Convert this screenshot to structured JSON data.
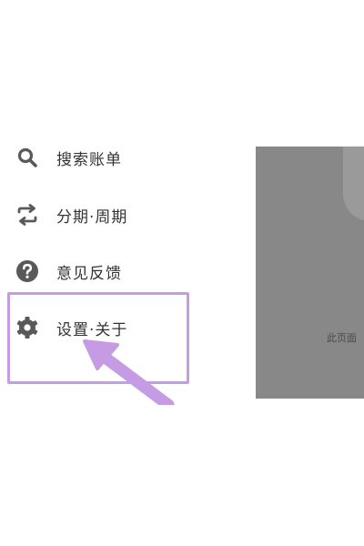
{
  "menu": {
    "items": [
      {
        "label": "搜索账单",
        "icon": "search-icon"
      },
      {
        "label": "分期·周期",
        "icon": "repeat-icon"
      },
      {
        "label": "意见反馈",
        "icon": "help-icon"
      },
      {
        "label": "设置·关于",
        "icon": "gear-icon"
      }
    ]
  },
  "overlay": {
    "peek_text": "此页面"
  },
  "colors": {
    "highlight": "#c59be3",
    "icon": "#595959",
    "overlay": "#888888"
  }
}
